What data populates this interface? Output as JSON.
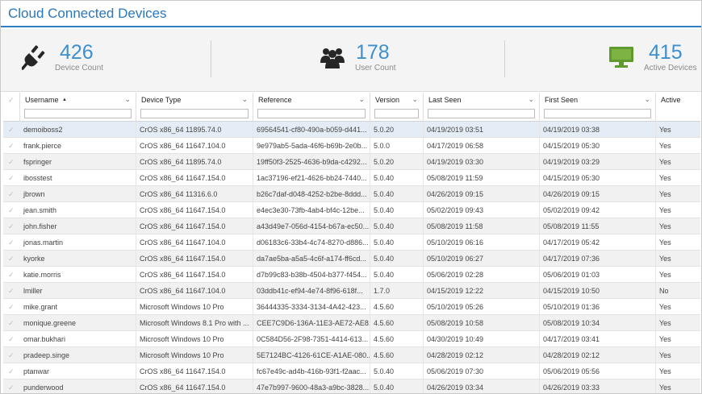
{
  "header": {
    "title": "Cloud Connected Devices"
  },
  "stats": {
    "devices": {
      "icon": "plug-icon",
      "value": "426",
      "label": "Device Count"
    },
    "users": {
      "icon": "users-icon",
      "value": "178",
      "label": "User Count"
    },
    "active": {
      "icon": "monitor-icon",
      "value": "415",
      "label": "Active Devices"
    }
  },
  "colors": {
    "accent": "#2b77b8",
    "stat_number": "#3d8fce",
    "monitor_green": "#5f9a2e",
    "selected_row": "#e4edf5"
  },
  "table": {
    "columns": [
      {
        "key": "username",
        "label": "Username",
        "sorted": "asc"
      },
      {
        "key": "device_type",
        "label": "Device Type"
      },
      {
        "key": "reference",
        "label": "Reference"
      },
      {
        "key": "version",
        "label": "Version"
      },
      {
        "key": "last_seen",
        "label": "Last Seen"
      },
      {
        "key": "first_seen",
        "label": "First Seen"
      },
      {
        "key": "active",
        "label": "Active"
      }
    ],
    "rows": [
      {
        "username": "demoiboss2",
        "device_type": "CrOS x86_64 11895.74.0",
        "reference": "69564541-cf80-490a-b059-d441...",
        "version": "5.0.20",
        "last_seen": "04/19/2019 03:51",
        "first_seen": "04/19/2019 03:38",
        "active": "Yes"
      },
      {
        "username": "frank.pierce",
        "device_type": "CrOS x86_64 11647.104.0",
        "reference": "9e979ab5-5ada-46f6-b69b-2e0b...",
        "version": "5.0.0",
        "last_seen": "04/17/2019 06:58",
        "first_seen": "04/15/2019 05:30",
        "active": "Yes"
      },
      {
        "username": "fspringer",
        "device_type": "CrOS x86_64 11895.74.0",
        "reference": "19ff50f3-2525-4636-b9da-c4292...",
        "version": "5.0.20",
        "last_seen": "04/19/2019 03:30",
        "first_seen": "04/19/2019 03:29",
        "active": "Yes"
      },
      {
        "username": "ibosstest",
        "device_type": "CrOS x86_64 11647.154.0",
        "reference": "1ac37196-ef21-4626-bb24-7440...",
        "version": "5.0.40",
        "last_seen": "05/08/2019 11:59",
        "first_seen": "04/15/2019 05:30",
        "active": "Yes"
      },
      {
        "username": "jbrown",
        "device_type": "CrOS x86_64 11316.6.0",
        "reference": "b26c7daf-d048-4252-b2be-8ddd...",
        "version": "5.0.40",
        "last_seen": "04/26/2019 09:15",
        "first_seen": "04/26/2019 09:15",
        "active": "Yes"
      },
      {
        "username": "jean.smith",
        "device_type": "CrOS x86_64 11647.154.0",
        "reference": "e4ec3e30-73fb-4ab4-bf4c-12be...",
        "version": "5.0.40",
        "last_seen": "05/02/2019 09:43",
        "first_seen": "05/02/2019 09:42",
        "active": "Yes"
      },
      {
        "username": "john.fisher",
        "device_type": "CrOS x86_64 11647.154.0",
        "reference": "a43d49e7-056d-4154-b67a-ec50...",
        "version": "5.0.40",
        "last_seen": "05/08/2019 11:58",
        "first_seen": "05/08/2019 11:55",
        "active": "Yes"
      },
      {
        "username": "jonas.martin",
        "device_type": "CrOS x86_64 11647.104.0",
        "reference": "d06183c6-33b4-4c74-8270-d886...",
        "version": "5.0.40",
        "last_seen": "05/10/2019 06:16",
        "first_seen": "04/17/2019 05:42",
        "active": "Yes"
      },
      {
        "username": "kyorke",
        "device_type": "CrOS x86_64 11647.154.0",
        "reference": "da7ae5ba-a5a5-4c6f-a174-ff6cd...",
        "version": "5.0.40",
        "last_seen": "05/10/2019 06:27",
        "first_seen": "04/17/2019 07:36",
        "active": "Yes"
      },
      {
        "username": "katie.morris",
        "device_type": "CrOS x86_64 11647.154.0",
        "reference": "d7b99c83-b38b-4504-b377-f454...",
        "version": "5.0.40",
        "last_seen": "05/06/2019 02:28",
        "first_seen": "05/06/2019 01:03",
        "active": "Yes"
      },
      {
        "username": "lmiller",
        "device_type": "CrOS x86_64 11647.104.0",
        "reference": "03ddb41c-ef94-4e74-8f96-618f...",
        "version": "1.7.0",
        "last_seen": "04/15/2019 12:22",
        "first_seen": "04/15/2019 10:50",
        "active": "No"
      },
      {
        "username": "mike.grant",
        "device_type": "Microsoft Windows 10 Pro",
        "reference": "36444335-3334-3134-4A42-423...",
        "version": "4.5.60",
        "last_seen": "05/10/2019 05:26",
        "first_seen": "05/10/2019 01:36",
        "active": "Yes"
      },
      {
        "username": "monique.greene",
        "device_type": "Microsoft Windows 8.1 Pro with ...",
        "reference": "CEE7C9D6-136A-11E3-AE72-AE8...",
        "version": "4.5.60",
        "last_seen": "05/08/2019 10:58",
        "first_seen": "05/08/2019 10:34",
        "active": "Yes"
      },
      {
        "username": "omar.bukhari",
        "device_type": "Microsoft Windows 10 Pro",
        "reference": "0C584D56-2F98-7351-4414-613...",
        "version": "4.5.60",
        "last_seen": "04/30/2019 10:49",
        "first_seen": "04/17/2019 03:41",
        "active": "Yes"
      },
      {
        "username": "pradeep.singe",
        "device_type": "Microsoft Windows 10 Pro",
        "reference": "5E7124BC-4126-61CE-A1AE-080...",
        "version": "4.5.60",
        "last_seen": "04/28/2019 02:12",
        "first_seen": "04/28/2019 02:12",
        "active": "Yes"
      },
      {
        "username": "ptanwar",
        "device_type": "CrOS x86_64 11647.154.0",
        "reference": "fc67e49c-ad4b-416b-93f1-f2aac...",
        "version": "5.0.40",
        "last_seen": "05/06/2019 07:30",
        "first_seen": "05/06/2019 05:56",
        "active": "Yes"
      },
      {
        "username": "punderwood",
        "device_type": "CrOS x86_64 11647.154.0",
        "reference": "47e7b997-9600-48a3-a9bc-3828...",
        "version": "5.0.40",
        "last_seen": "04/26/2019 03:34",
        "first_seen": "04/26/2019 03:33",
        "active": "Yes"
      }
    ]
  }
}
